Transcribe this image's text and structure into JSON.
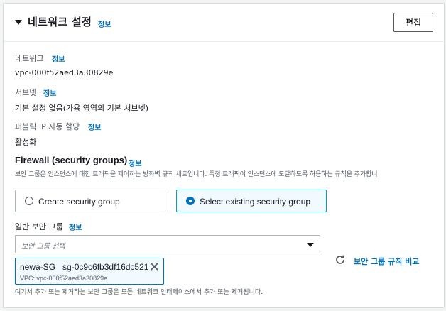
{
  "header": {
    "title": "네트워크 설정",
    "info": "정보",
    "edit_label": "편집"
  },
  "network": {
    "label": "네트워크",
    "info": "정보",
    "value": "vpc-000f52aed3a30829e"
  },
  "subnet": {
    "label": "서브넷",
    "info": "정보",
    "value": "기본 설정 없음(가용 영역의 기본 서브넷)"
  },
  "public_ip": {
    "label": "퍼블릭 IP 자동 할당",
    "info": "정보",
    "value": "활성화"
  },
  "firewall": {
    "title": "Firewall (security groups)",
    "info": "정보",
    "description": "보안 그룹은 인스턴스에 대한 트래픽을 제어하는 방화벽 규칙 세트입니다. 특정 트래픽이 인스턴스에 도달하도록 허용하는 규칙을 추가합니",
    "options": [
      {
        "label": "Create security group",
        "selected": false
      },
      {
        "label": "Select existing security group",
        "selected": true
      }
    ]
  },
  "common_sg": {
    "label": "일반 보안 그룹",
    "info": "정보",
    "placeholder": "보안 그룹 선택",
    "selected_token": {
      "name": "newa-SG   sg-0c9c6fb3df16dc521",
      "vpc": "VPC: vpc-000f52aed3a30829e"
    },
    "compare_label": "보안 그룹 규칙 비교",
    "footnote": "여기서 추가 또는 제거하는 보안 그룹은 모든 네트워크 인터페이스에서 추가 또는 제거됩니다."
  },
  "colors": {
    "link": "#0073bb",
    "selected_bg": "#f1faff",
    "border": "#aab7b8"
  },
  "icons": {
    "caret": "caret-down-icon",
    "refresh": "refresh-icon",
    "close": "close-icon",
    "dropdown": "chevron-down-icon"
  }
}
